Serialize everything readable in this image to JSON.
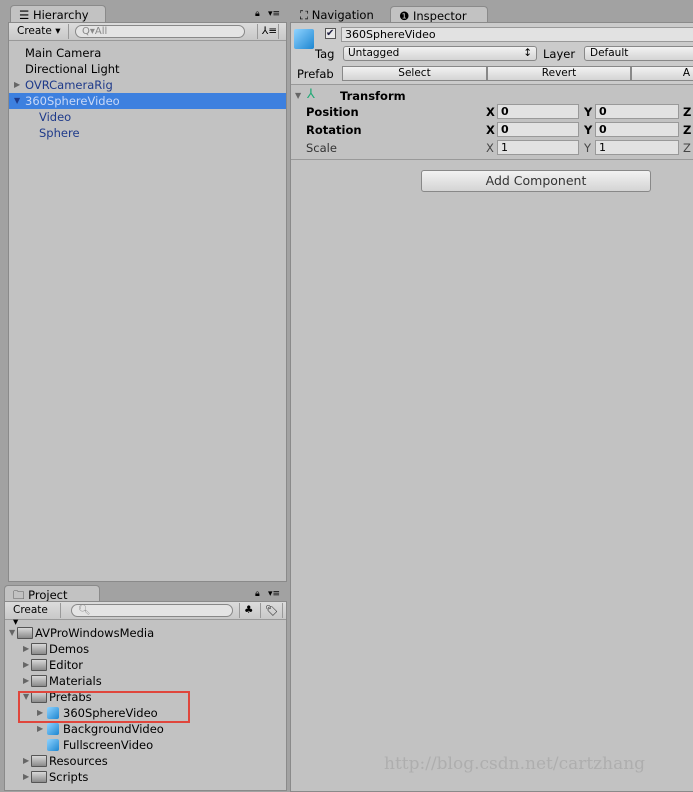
{
  "hierarchy": {
    "tab_label": "Hierarchy",
    "create_label": "Create",
    "search_placeholder": "All",
    "items": [
      {
        "label": "Main Camera"
      },
      {
        "label": "Directional Light"
      },
      {
        "label": "OVRCameraRig"
      },
      {
        "label": "360SphereVideo"
      },
      {
        "label": "Video"
      },
      {
        "label": "Sphere"
      }
    ]
  },
  "project": {
    "tab_label": "Project",
    "create_label": "Create",
    "search_placeholder": "",
    "items": [
      {
        "label": "AVProWindowsMedia"
      },
      {
        "label": "Demos"
      },
      {
        "label": "Editor"
      },
      {
        "label": "Materials"
      },
      {
        "label": "Prefabs"
      },
      {
        "label": "360SphereVideo"
      },
      {
        "label": "BackgroundVideo"
      },
      {
        "label": "FullscreenVideo"
      },
      {
        "label": "Resources"
      },
      {
        "label": "Scripts"
      }
    ],
    "highlight_color": "#e0463c"
  },
  "inspector": {
    "tabs": [
      {
        "label": "Navigation"
      },
      {
        "label": "Inspector"
      }
    ],
    "object_name": "360SphereVideo",
    "tag_label": "Tag",
    "tag_value": "Untagged",
    "layer_label": "Layer",
    "layer_value": "Default",
    "prefab_label": "Prefab",
    "prefab_buttons": [
      "Select",
      "Revert",
      "A"
    ],
    "transform": {
      "title": "Transform",
      "rows": [
        {
          "label": "Position",
          "x": "0",
          "y": "0"
        },
        {
          "label": "Rotation",
          "x": "0",
          "y": "0"
        },
        {
          "label": "Scale",
          "x": "1",
          "y": "1"
        }
      ],
      "axis": [
        "X",
        "Y",
        "Z"
      ]
    },
    "add_component_label": "Add Component"
  },
  "watermark": "http://blog.csdn.net/cartzhang",
  "colors": {
    "selection": "#3d80df",
    "panel": "#c2c2c2"
  }
}
